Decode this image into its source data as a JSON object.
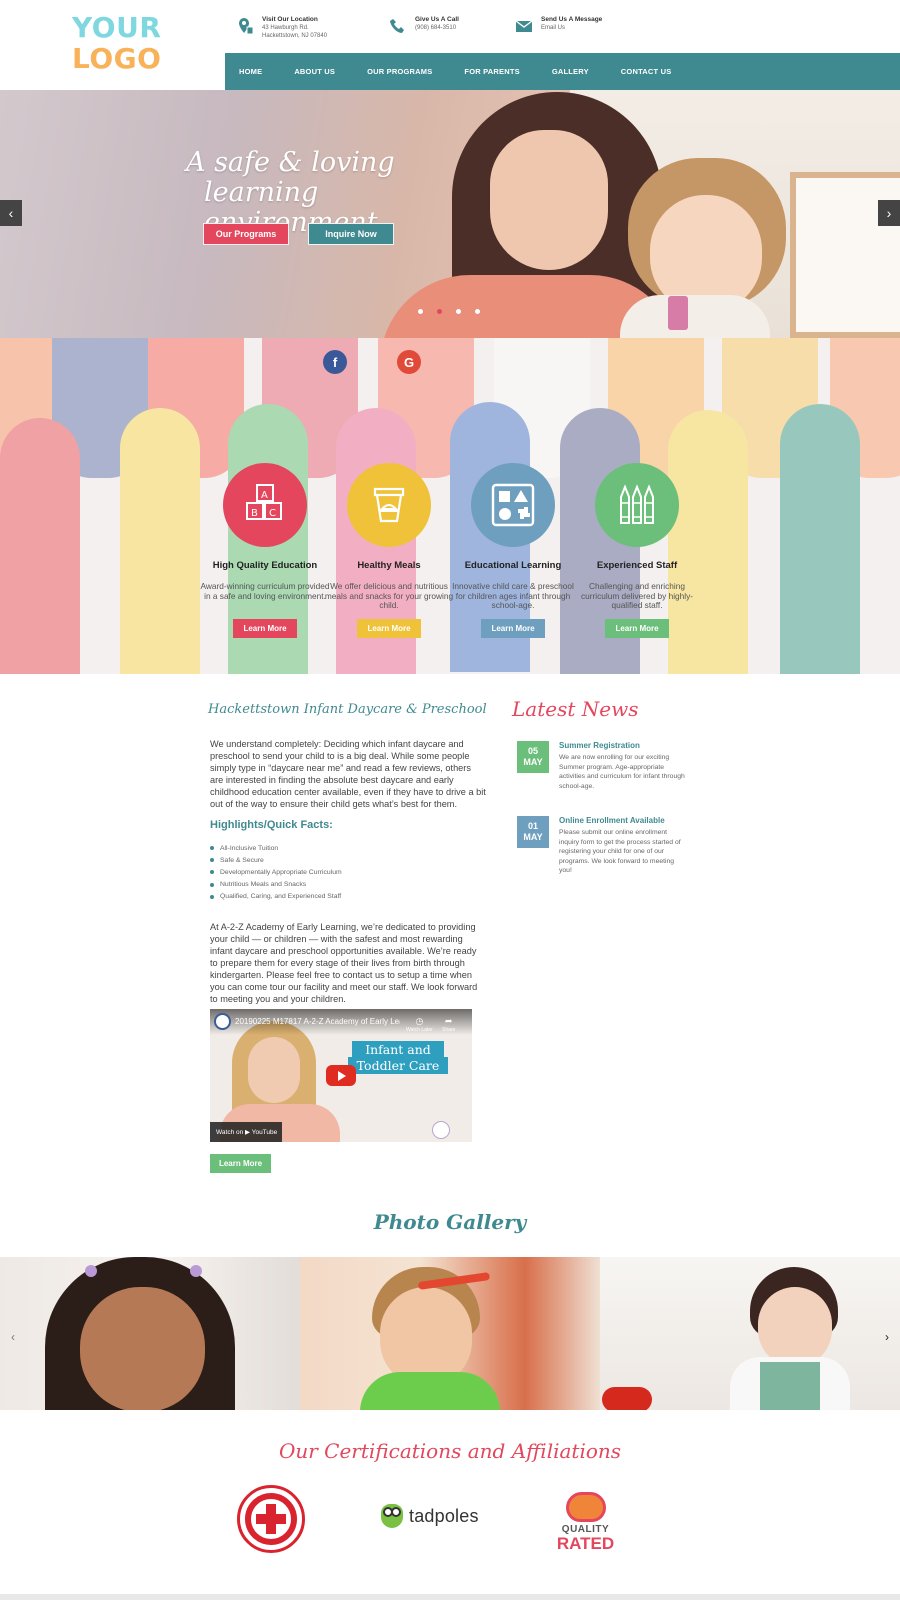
{
  "logo": {
    "line1": "YOUR",
    "line2": "LOGO"
  },
  "contacts": [
    {
      "title": "Visit Our Location",
      "line1": "43 Hawburgh Rd.",
      "line2": "Hackettstown, NJ 07840",
      "icon": "location-icon"
    },
    {
      "title": "Give Us A Call",
      "line1": "(908) 684-3510",
      "line2": "",
      "icon": "phone-icon"
    },
    {
      "title": "Send Us A Message",
      "line1": "Email Us",
      "line2": "",
      "icon": "mail-icon"
    }
  ],
  "nav": {
    "items": [
      "HOME",
      "ABOUT US",
      "OUR PROGRAMS",
      "FOR PARENTS",
      "GALLERY",
      "CONTACT US"
    ]
  },
  "hero": {
    "title_line1": "A safe & loving",
    "title_line2": "learning environment",
    "button1": "Our Programs",
    "button2": "Inquire Now",
    "prev": "‹",
    "next": "›",
    "slide_count": 4,
    "active_slide": 2
  },
  "social": {
    "facebook": "f",
    "google": "G"
  },
  "features": [
    {
      "title": "High Quality Education",
      "text": "Award-winning curriculum provided in a safe and loving environment.",
      "button": "Learn More",
      "color": "#e4475d",
      "icon": "abc-blocks-icon"
    },
    {
      "title": "Healthy Meals",
      "text": "We offer delicious and nutritious meals and snacks for your growing child.",
      "button": "Learn More",
      "color": "#f0c23a",
      "icon": "food-container-icon"
    },
    {
      "title": "Educational Learning",
      "text": "Innovative child care & preschool for children ages infant through school-age.",
      "button": "Learn More",
      "color": "#6f9fbf",
      "icon": "shape-sorter-icon"
    },
    {
      "title": "Experienced Staff",
      "text": "Challenging and enriching curriculum delivered by highly-qualified staff.",
      "button": "Learn More",
      "color": "#6bbf7a",
      "icon": "crayons-icon"
    }
  ],
  "content": {
    "title": "Hackettstown Infant Daycare & Preschool",
    "intro": "We understand completely: Deciding which infant daycare and preschool to send your child to is a big deal. While some people simply type in “daycare near me” and read a few reviews, others are interested in finding the absolute best daycare and early childhood education center available, even if they have to drive a bit out of the way to ensure their child gets what’s best for them.",
    "highlights_title": "Highlights/Quick Facts:",
    "highlights": [
      "All-Inclusive Tuition",
      "Safe & Secure",
      "Developmentally Appropriate Curriculum",
      "Nutritious Meals and Snacks",
      "Qualified, Caring, and Experienced Staff"
    ],
    "body": "At A-2-Z Academy of Early Learning, we’re dedicated to providing your child — or children — with the safest and most rewarding infant daycare and preschool opportunities available. We’re ready to prepare them for every stage of their lives from birth through kindergarten. Please feel free to contact us to setup a time when you can come tour our facility and meet our staff. We look forward to meeting you and your children.",
    "video": {
      "title": "20190225 M17817 A-2-Z Academy of Early Lea...",
      "watch_later": "Watch Later",
      "share": "Share",
      "banner1": "Infant and",
      "banner2": "Toddler Care",
      "watch_on": "Watch on ▶ YouTube"
    },
    "button": "Learn More"
  },
  "news": {
    "title": "Latest News",
    "items": [
      {
        "day": "05",
        "month": "MAY",
        "color": "#6bbf7a",
        "headline": "Summer Registration",
        "text": "We are now enrolling for our exciting Summer program. Age-appropriate activities and curriculum for infant through school-age."
      },
      {
        "day": "01",
        "month": "MAY",
        "color": "#6f9fbf",
        "headline": "Online Enrollment Available",
        "text": "Please submit our online enrollment inquiry form to get the process started of registering your child for one of our programs. We look forward to meeting you!"
      }
    ]
  },
  "gallery": {
    "title": "Photo Gallery",
    "prev": "‹",
    "next": "›"
  },
  "certifications": {
    "title": "Our Certifications and Affiliations",
    "tadpoles": "tadpoles",
    "quality": "QUALITY",
    "rated": "RATED"
  }
}
